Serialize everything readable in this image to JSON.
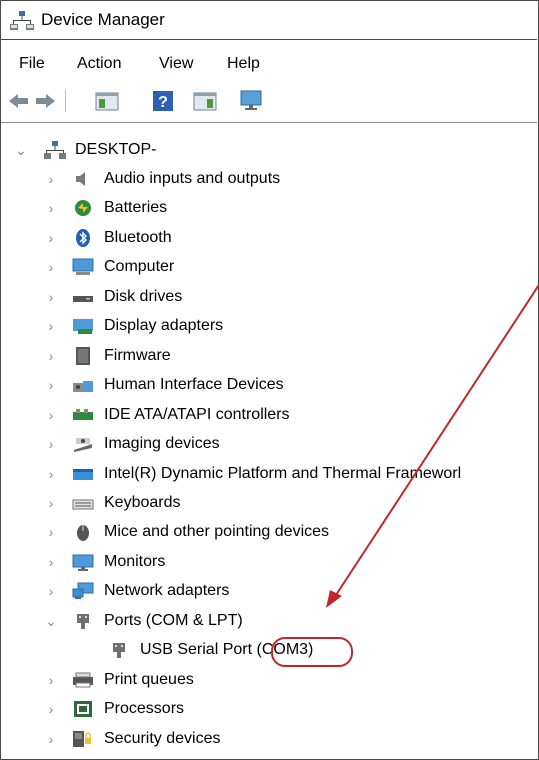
{
  "window": {
    "title": "Device Manager"
  },
  "menu": [
    {
      "key": "file",
      "label": "File"
    },
    {
      "key": "action",
      "label": "Action"
    },
    {
      "key": "view",
      "label": "View"
    },
    {
      "key": "help",
      "label": "Help"
    }
  ],
  "toolbar": [
    {
      "name": "back-icon"
    },
    {
      "name": "forward-icon"
    },
    {
      "name": "show-hide-console-tree-icon"
    },
    {
      "name": "help-icon"
    },
    {
      "name": "show-hide-action-pane-icon"
    },
    {
      "name": "monitor-icon"
    }
  ],
  "tree": {
    "root": {
      "label": "DESKTOP-",
      "expanded": true
    },
    "items": [
      {
        "label": "Audio inputs and outputs",
        "icon": "speaker-icon",
        "expanded": false
      },
      {
        "label": "Batteries",
        "icon": "battery-icon",
        "expanded": false
      },
      {
        "label": "Bluetooth",
        "icon": "bluetooth-icon",
        "expanded": false
      },
      {
        "label": "Computer",
        "icon": "computer-icon",
        "expanded": false
      },
      {
        "label": "Disk drives",
        "icon": "disk-drive-icon",
        "expanded": false
      },
      {
        "label": "Display adapters",
        "icon": "display-adapter-icon",
        "expanded": false
      },
      {
        "label": "Firmware",
        "icon": "firmware-icon",
        "expanded": false
      },
      {
        "label": "Human Interface Devices",
        "icon": "hid-icon",
        "expanded": false
      },
      {
        "label": "IDE ATA/ATAPI controllers",
        "icon": "ide-controller-icon",
        "expanded": false
      },
      {
        "label": "Imaging devices",
        "icon": "imaging-device-icon",
        "expanded": false
      },
      {
        "label": "Intel(R) Dynamic Platform and Thermal Frameworl",
        "icon": "intel-framework-icon",
        "expanded": false
      },
      {
        "label": "Keyboards",
        "icon": "keyboard-icon",
        "expanded": false
      },
      {
        "label": "Mice and other pointing devices",
        "icon": "mouse-icon",
        "expanded": false
      },
      {
        "label": "Monitors",
        "icon": "monitor-icon",
        "expanded": false
      },
      {
        "label": "Network adapters",
        "icon": "network-adapter-icon",
        "expanded": false
      },
      {
        "label": "Ports (COM & LPT)",
        "icon": "port-icon",
        "expanded": true,
        "children": [
          {
            "label": "USB Serial Port ",
            "port": "(COM3)",
            "icon": "port-icon"
          }
        ]
      },
      {
        "label": "Print queues",
        "icon": "printer-icon",
        "expanded": false
      },
      {
        "label": "Processors",
        "icon": "processor-icon",
        "expanded": false
      },
      {
        "label": "Security devices",
        "icon": "security-device-icon",
        "expanded": false
      }
    ]
  },
  "annotation": {
    "color": "#c0272d"
  }
}
